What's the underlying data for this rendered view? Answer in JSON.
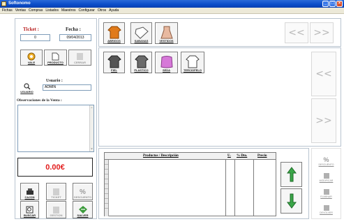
{
  "window": {
    "title": "Softonomo"
  },
  "menu": [
    "Fichas",
    "Ventas",
    "Compras",
    "Listados",
    "Maestros",
    "Configurar",
    "Otros",
    "Ayuda"
  ],
  "ticket": {
    "label": "Ticket :",
    "value": "0"
  },
  "fecha": {
    "label": "Fecha :",
    "value": "09/04/2013"
  },
  "actions_top": [
    "VALE",
    "PRODUCTO",
    "CERRAR"
  ],
  "usuario": {
    "label": "Usuario :",
    "value": "ADMIN",
    "button": "USUARIO"
  },
  "observaciones": {
    "label": "Observaciones de la Venta :"
  },
  "categories_row1": [
    "ABRIGOS",
    "SABANAS",
    "VESTIDOS"
  ],
  "categories_row2": [
    "PIEL",
    "PLASTICO",
    "SEDA",
    "TERCIOPELO"
  ],
  "nav": {
    "prev": "<<",
    "next": ">>"
  },
  "total": "0.00€",
  "bottom_buttons": [
    {
      "label": "CAJON",
      "enabled": true
    },
    {
      "label": "TICKET",
      "enabled": false
    },
    {
      "label": "DESCUENTO",
      "enabled": false
    },
    {
      "label": "BUSCAR",
      "enabled": true
    },
    {
      "label": "GESTION",
      "enabled": false
    },
    {
      "label": "SALVER",
      "enabled": true
    }
  ],
  "table": {
    "headers": [
      "Productos / Descripción",
      "U.",
      "% Dto.",
      "Precio"
    ]
  },
  "side_actions": [
    "DESCUENTO",
    "MODIFICAR",
    "ELIMINAR",
    "DEVOLVER"
  ],
  "colors": {
    "total": "#e21b1b",
    "ticket_label": "#b71c1c",
    "arrows": "#3aa648"
  }
}
